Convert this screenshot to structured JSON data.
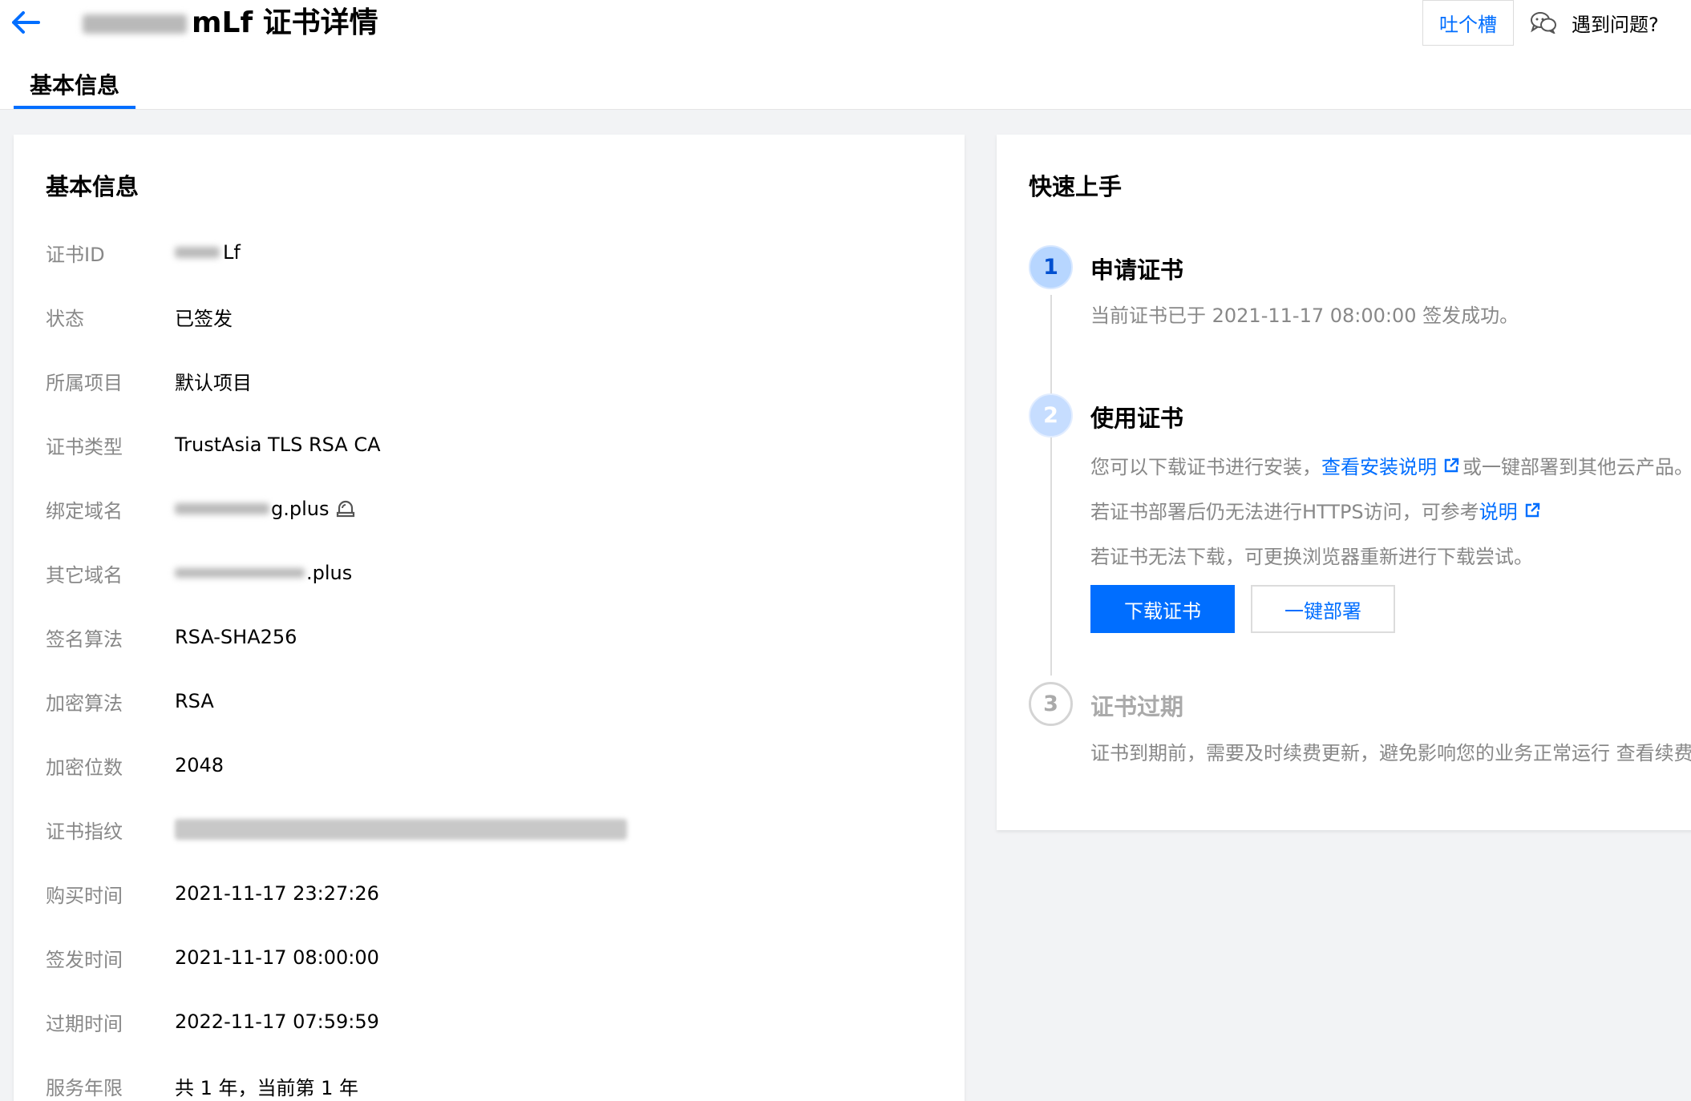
{
  "header": {
    "title_visible": "mLf 证书详情",
    "feedback_button": "吐个槽",
    "help_link": "遇到问题?",
    "tab_basic": "基本信息"
  },
  "basic_info": {
    "title": "基本信息",
    "rows": [
      {
        "label": "证书ID",
        "value": "Lf"
      },
      {
        "label": "状态",
        "value": "已签发"
      },
      {
        "label": "所属项目",
        "value": "默认项目"
      },
      {
        "label": "证书类型",
        "value": "TrustAsia TLS RSA CA"
      },
      {
        "label": "绑定域名",
        "value": "g.plus"
      },
      {
        "label": "其它域名",
        "value": ".plus"
      },
      {
        "label": "签名算法",
        "value": "RSA-SHA256"
      },
      {
        "label": "加密算法",
        "value": "RSA"
      },
      {
        "label": "加密位数",
        "value": "2048"
      },
      {
        "label": "证书指纹",
        "value": ""
      },
      {
        "label": "购买时间",
        "value": "2021-11-17 23:27:26"
      },
      {
        "label": "签发时间",
        "value": "2021-11-17 08:00:00"
      },
      {
        "label": "过期时间",
        "value": "2022-11-17 07:59:59"
      },
      {
        "label": "服务年限",
        "value": "共 1 年，当前第 1 年"
      }
    ]
  },
  "quick_start": {
    "title": "快速上手",
    "steps": [
      {
        "number": "1",
        "title": "申请证书",
        "text": "当前证书已于 2021-11-17 08:00:00 签发成功。"
      },
      {
        "number": "2",
        "title": "使用证书",
        "line1_prefix": "您可以下载证书进行安装，",
        "line1_link": "查看安装说明",
        "line1_suffix": "或一键部署到其他云产品。",
        "line2_prefix": "若证书部署后仍无法进行HTTPS访问，可参考",
        "line2_link": "说明",
        "line3": "若证书无法下载，可更换浏览器重新进行下载尝试。",
        "download_button": "下载证书",
        "deploy_button": "一键部署"
      },
      {
        "number": "3",
        "title": "证书过期",
        "text": "证书到期前，需要及时续费更新，避免影响您的业务正常运行 查看续费"
      }
    ]
  },
  "colors": {
    "accent": "#006eff",
    "label": "#888888",
    "background": "#f2f3f5"
  },
  "icons": [
    "back-arrow-icon",
    "wechat-icon",
    "lock-icon",
    "external-link-icon"
  ]
}
